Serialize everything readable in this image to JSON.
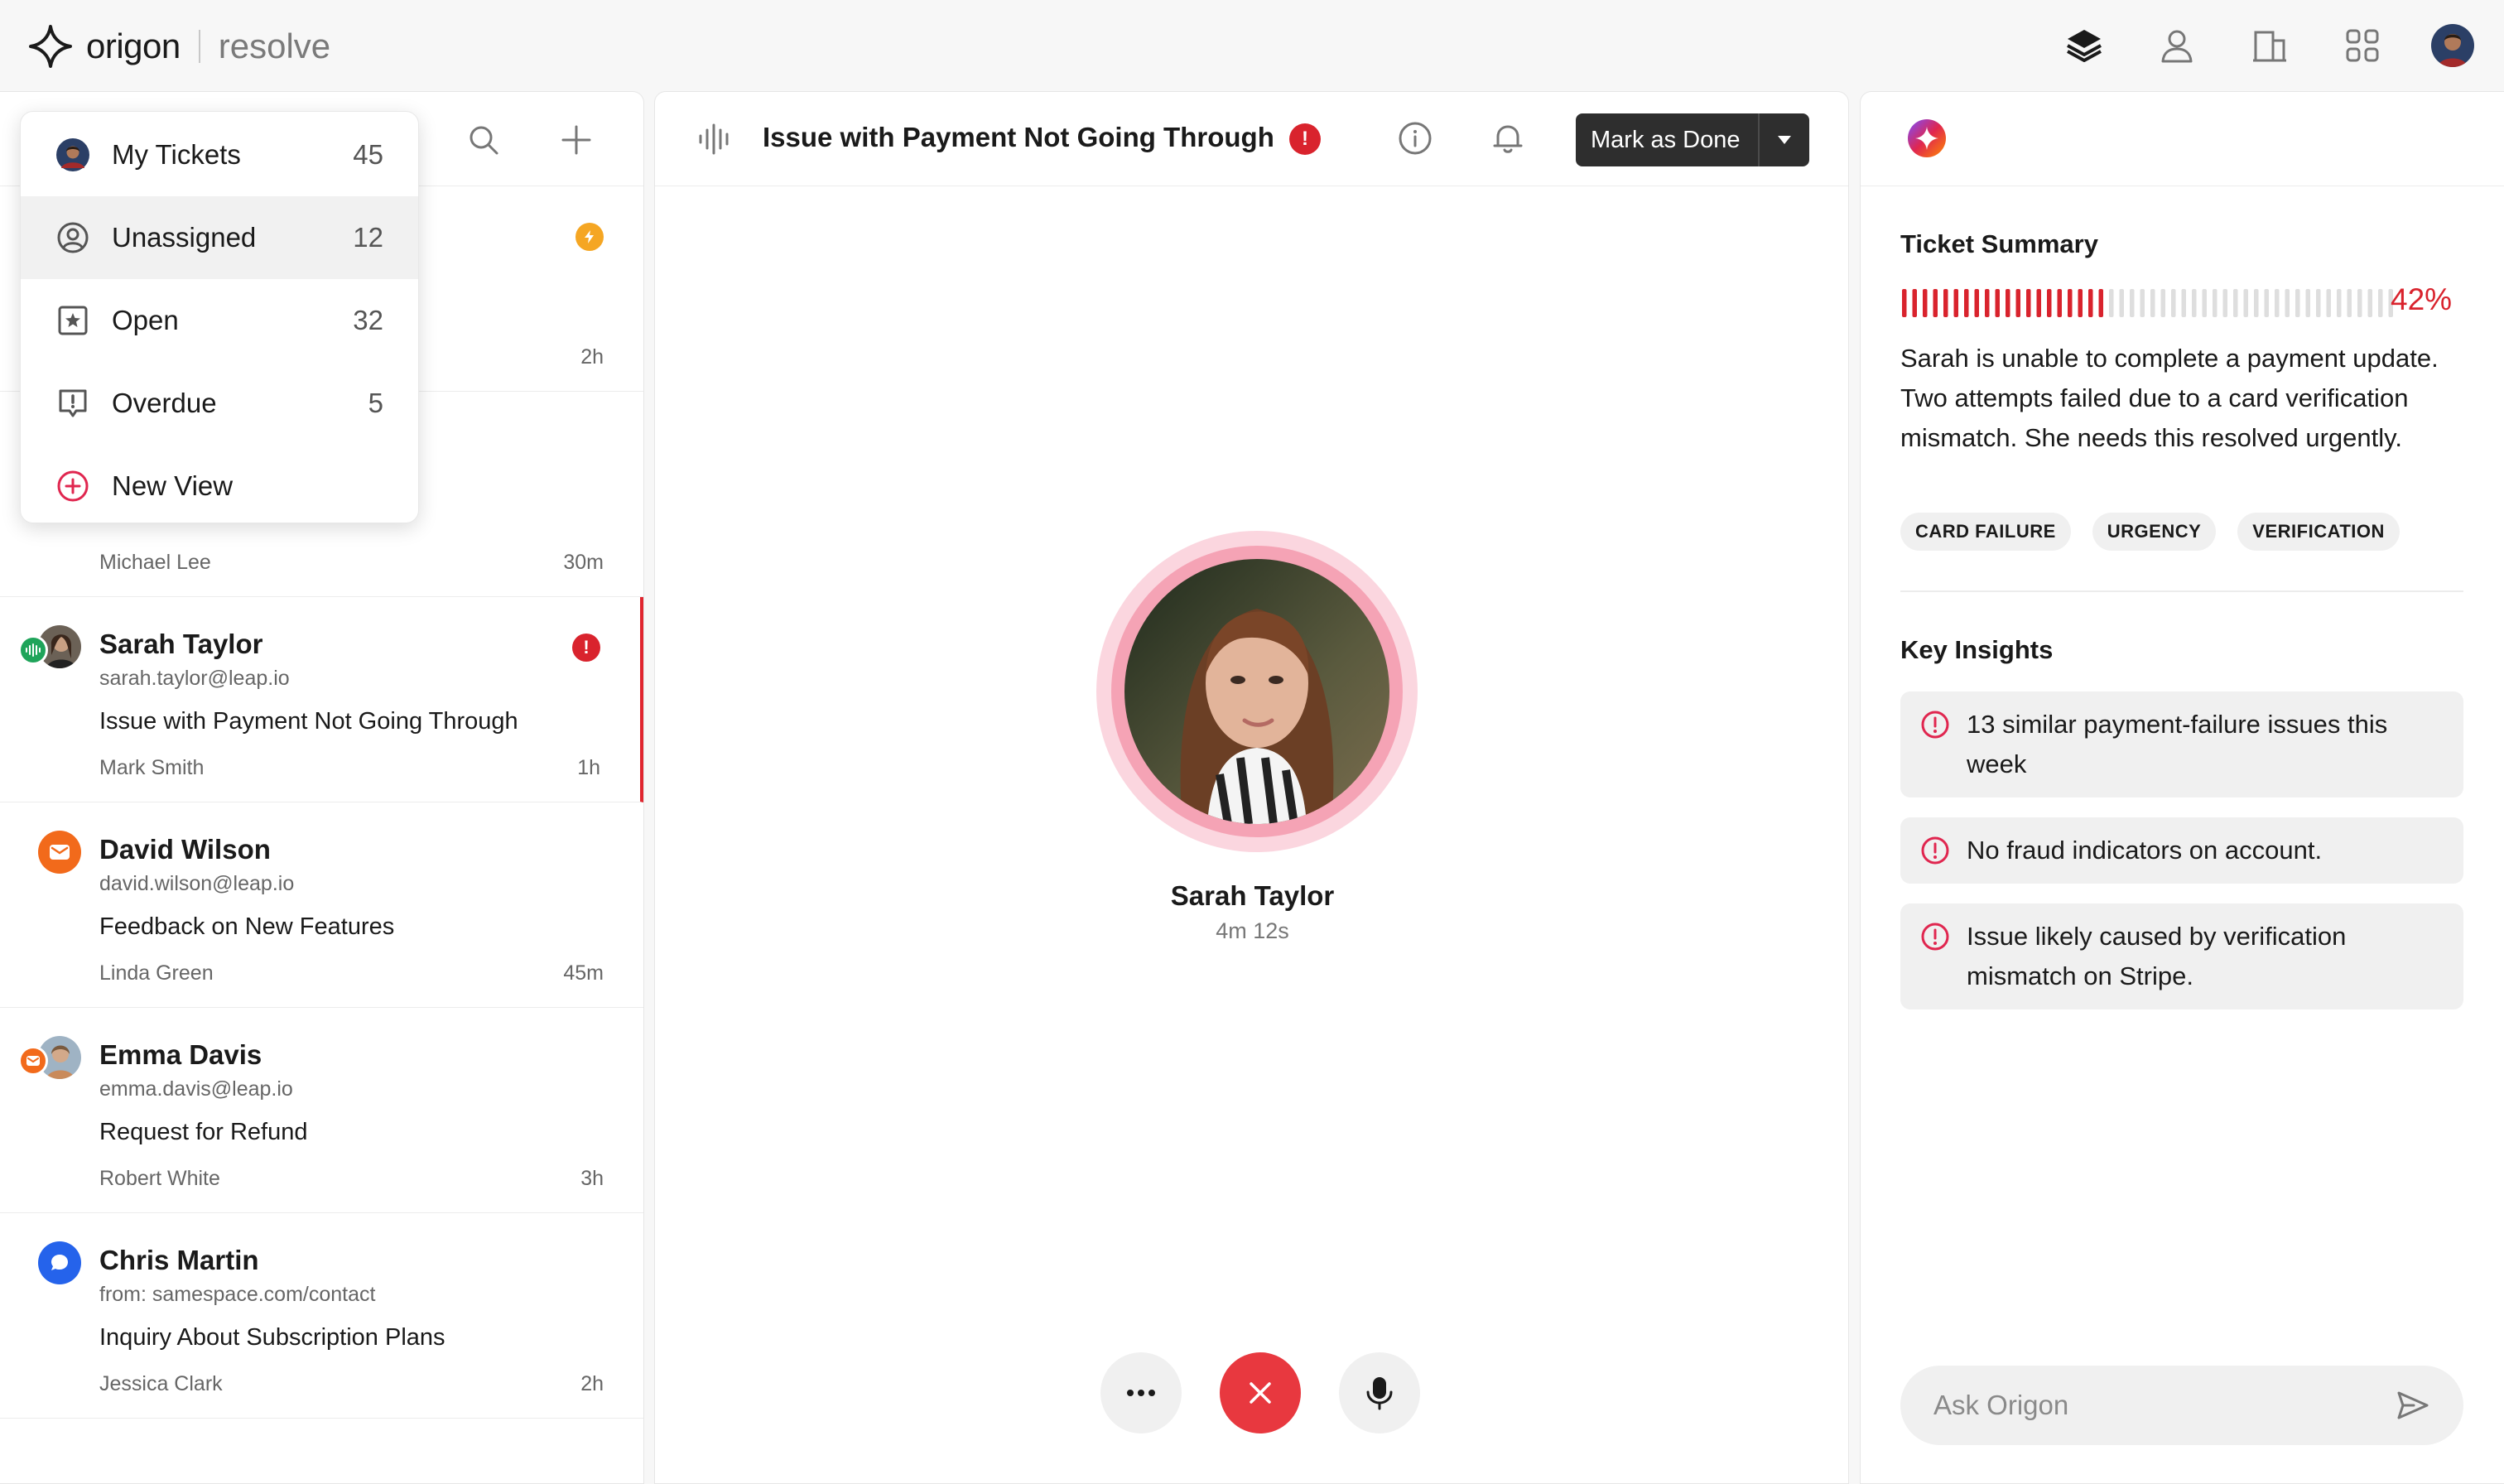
{
  "app": {
    "brand_name": "origon",
    "product_name": "resolve",
    "top_icons": [
      "layers-icon",
      "user-icon",
      "building-icon",
      "grid-icon",
      "avatar"
    ]
  },
  "dropdown": {
    "items": [
      {
        "label": "My Tickets",
        "count": "45",
        "icon": "avatar"
      },
      {
        "label": "Unassigned",
        "count": "12",
        "icon": "user-circle-icon"
      },
      {
        "label": "Open",
        "count": "32",
        "icon": "star-square-icon"
      },
      {
        "label": "Overdue",
        "count": "5",
        "icon": "alert-message-icon"
      },
      {
        "label": "New View",
        "count": "",
        "icon": "plus-circle-icon"
      }
    ]
  },
  "tickets": [
    {
      "name": "",
      "email": "",
      "subject": "",
      "agent": "",
      "time": "2h",
      "flag": "orange-badge"
    },
    {
      "name": "",
      "email": "",
      "subject": "",
      "agent": "Michael Lee",
      "time": "30m"
    },
    {
      "name": "Sarah Taylor",
      "email": "sarah.taylor@leap.io",
      "subject": "Issue with Payment Not Going Through",
      "agent": "Mark Smith",
      "time": "1h",
      "flag": "!",
      "channel": "voice",
      "active": true
    },
    {
      "name": "David Wilson",
      "email": "david.wilson@leap.io",
      "subject": "Feedback on New Features",
      "agent": "Linda Green",
      "time": "45m",
      "channel": "email"
    },
    {
      "name": "Emma Davis",
      "email": "emma.davis@leap.io",
      "subject": "Request for Refund",
      "agent": "Robert White",
      "time": "3h",
      "channel": "email"
    },
    {
      "name": "Chris Martin",
      "email": "from: samespace.com/contact",
      "subject": "Inquiry About Subscription Plans",
      "agent": "Jessica Clark",
      "time": "2h",
      "channel": "chat"
    }
  ],
  "conversation": {
    "title": "Issue with Payment Not Going Through",
    "alert": "!",
    "mark_done_label": "Mark as Done",
    "caller_name": "Sarah Taylor",
    "call_duration": "4m 12s"
  },
  "assistant": {
    "summary_title": "Ticket Summary",
    "progress_pct": "42%",
    "progress_value": 0.42,
    "summary_text": "Sarah is unable to complete a payment update. Two attempts failed due to a card verification mismatch. She needs this resolved urgently.",
    "tags": [
      "CARD FAILURE",
      "URGENCY",
      "VERIFICATION"
    ],
    "insights_title": "Key Insights",
    "insights": [
      "13 similar payment-failure issues this week",
      "No fraud indicators on account.",
      "Issue likely caused by verification mismatch on Stripe."
    ],
    "ask_placeholder": "Ask Origon"
  },
  "colors": {
    "accent_red": "#d9232d",
    "dark_button": "#2e2e2e",
    "orange": "#f26a1b",
    "blue": "#2563eb",
    "green": "#1fa45a",
    "pink_ring": "#f5a3b5"
  }
}
